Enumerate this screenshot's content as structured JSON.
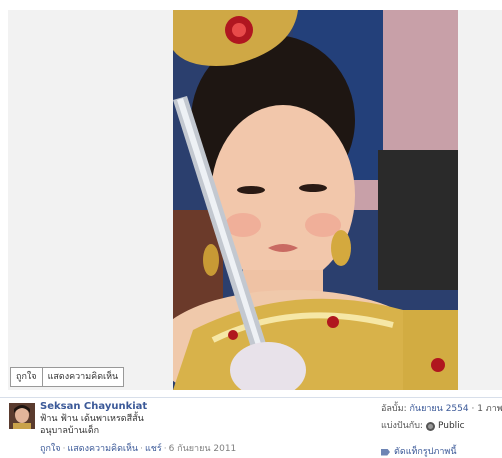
{
  "photo_actions": {
    "like": "ถูกใจ",
    "comment": "แสดงความคิดเห็น"
  },
  "post": {
    "author": "Seksan Chayunkiat",
    "caption_line1": "ฟ้าน ฟ้าน เด้นพาเหรดสีสั้น",
    "caption_line2": "อนุบาลบ้านเด็ก",
    "like": "ถูกใจ",
    "comment": "แสดงความคิดเห็น",
    "share": "แชร์",
    "date": "6 กันยายน 2011",
    "sep": "·"
  },
  "info": {
    "uploaded_prefix": "อัลบั้ม:",
    "album": "กันยายน 2554",
    "album_count": "· 1 ภาพ",
    "shared_with": "แบ่งปันกับ:",
    "visibility": "Public",
    "tag_link": "ตัดแท็กรูปภาพนี้"
  }
}
